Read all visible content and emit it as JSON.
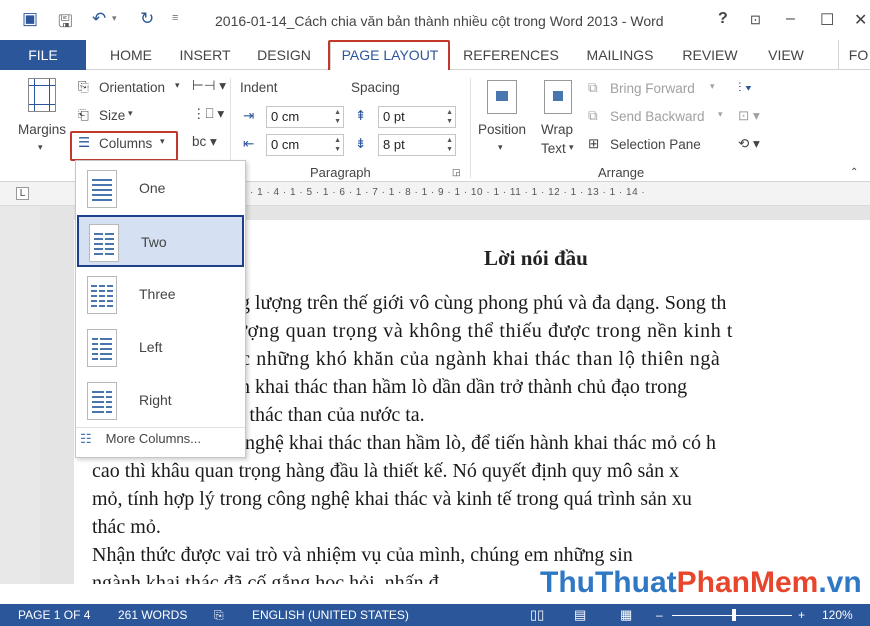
{
  "titlebar": {
    "title": "2016-01-14_Cách chia văn bản thành nhiều cột trong Word 2013 - Word",
    "help": "?",
    "restore_icon": "ribbon-display-icon",
    "minimize": "–",
    "maximize": "☐",
    "close": "✕"
  },
  "tabs": [
    "FILE",
    "HOME",
    "INSERT",
    "DESIGN",
    "PAGE LAYOUT",
    "REFERENCES",
    "MAILINGS",
    "REVIEW",
    "VIEW",
    "FO"
  ],
  "ribbon": {
    "margins": "Margins",
    "orientation": "Orientation",
    "size": "Size",
    "columns": "Columns",
    "paragraph": {
      "indent_label": "Indent",
      "spacing_label": "Spacing",
      "indent_left": "0 cm",
      "indent_right": "0 cm",
      "spacing_before": "0 pt",
      "spacing_after": "8 pt",
      "group_label": "Paragraph"
    },
    "arrange": {
      "position": "Position",
      "wrap": "Wrap",
      "wrap2": "Text",
      "bring_forward": "Bring Forward",
      "send_backward": "Send Backward",
      "selection_pane": "Selection Pane",
      "group_label": "Arrange"
    }
  },
  "ruler": {
    "ticks": "· 1 · 4 · 1 · 5 · 1 · 6 · 1 · 7 · 1 · 8 · 1 · 9 · 1 · 10 · 1 · 11 · 1 · 12 · 1 · 13 · 1 · 14 ·"
  },
  "columns_menu": {
    "items": [
      "One",
      "Two",
      "Three",
      "Left",
      "Right"
    ],
    "more": "More Columns...",
    "selected": "Two"
  },
  "document": {
    "heading": "Lời nói đầu",
    "lines": [
      "ng lượng trên thế giới vô cùng phong phú và đa dạng. Song th",
      "lượng quan trọng và không thể thiếu được trong nền kinh t",
      "ớc những khó khăn của ngành khai thác than lộ thiên ngà",
      "nh khai thác than hầm lò dần dần trở thành chủ đạo trong",
      "ai thác than của nước ta.",
      "g nghệ khai thác than hầm lò, để tiến hành khai thác mỏ có h",
      "cao thì khâu quan trọng hàng đầu là thiết kế.  Nó quyết định quy mô sản x",
      "mỏ, tính hợp lý trong công nghệ khai thác và kinh tế trong quá trình sản xu",
      "thác mỏ.",
      "       Nhận thức được vai trò và nhiệm vụ của mình, chúng em những sin",
      "ngành khai thác đã cố gắng học hỏi, nhấn đ"
    ]
  },
  "status": {
    "page": "PAGE 1 OF 4",
    "words": "261 WORDS",
    "language": "ENGLISH (UNITED STATES)",
    "zoom": "120%",
    "zoom_minus": "–",
    "zoom_plus": "+"
  },
  "watermark": {
    "part1": "ThuThuat",
    "part2": "PhanMem",
    "part3": ".vn"
  }
}
